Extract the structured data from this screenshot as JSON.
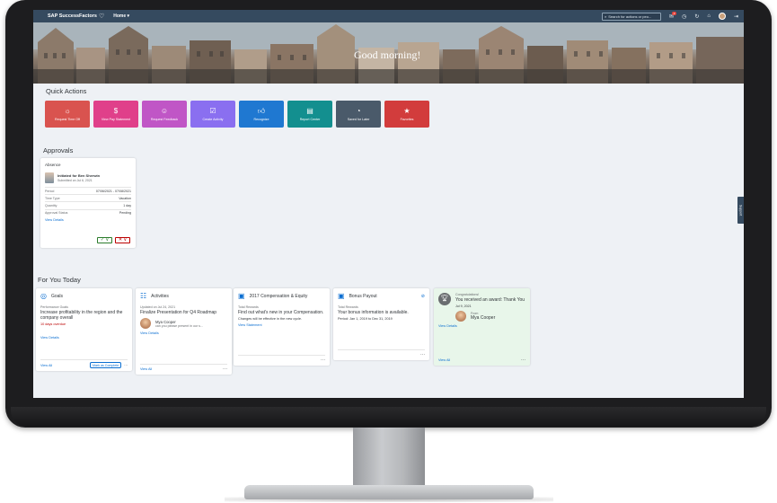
{
  "topbar": {
    "brand": "SAP SuccessFactors",
    "home_menu": "Home ▾",
    "search_placeholder": "Search for actions or peo...",
    "notification_count": "2"
  },
  "banner": {
    "greeting": "Good morning!"
  },
  "quick_actions": {
    "title": "Quick Actions",
    "tiles": [
      {
        "label": "Request Time Off",
        "icon": "sun-icon",
        "color": "#d9534f"
      },
      {
        "label": "View Pay Statement",
        "icon": "dollar-doc-icon",
        "color": "#e0408a"
      },
      {
        "label": "Request Feedback",
        "icon": "people-icon",
        "color": "#c056c6"
      },
      {
        "label": "Create Activity",
        "icon": "clipboard-icon",
        "color": "#8a6ff0"
      },
      {
        "label": "Recognize",
        "icon": "thumbs-up-icon",
        "color": "#1f78d1"
      },
      {
        "label": "Report Center",
        "icon": "report-icon",
        "color": "#138f8f"
      },
      {
        "label": "Saved for Later",
        "icon": "bookmark-icon",
        "color": "#4a5a6a"
      },
      {
        "label": "Favorites",
        "icon": "star-icon",
        "color": "#d23c3c"
      }
    ]
  },
  "approvals": {
    "title": "Approvals",
    "card": {
      "title": "Absence",
      "initiated": "Initiated for Ben Sherwin",
      "submitted": "Submitted on Jul 6, 2021",
      "rows": [
        {
          "k": "Period",
          "v": "07/06/2021 - 07/08/2021"
        },
        {
          "k": "Time Type",
          "v": "Vacation"
        },
        {
          "k": "Quantity",
          "v": "1 day"
        },
        {
          "k": "Approval Status",
          "v": "Pending"
        }
      ],
      "view_details": "View Details",
      "accept": "✓ ∨",
      "reject": "✕ ∨"
    }
  },
  "support_tab": "Support",
  "for_you": {
    "title": "For You Today",
    "goals": {
      "title": "Goals",
      "category": "Performance Goals",
      "main": "Increase profitability in the region and the company overall",
      "note": "10 days overdue",
      "link": "View Details",
      "view_all": "View All",
      "mark": "Mark as Complete",
      "more": "···"
    },
    "activities": {
      "title": "Activities",
      "category": "Updated on Jul 24, 2021",
      "main": "Finalize Presentation for Q4 Roadmap",
      "person": "Mya Cooper",
      "snippet": "can you please present in our s...",
      "link": "View Details",
      "view_all": "View All",
      "more": "···"
    },
    "compensation": {
      "title": "2017 Compensation & Equity",
      "category": "Total Rewards",
      "main": "Find out what's new in your Compensation.",
      "note": "Changes will be effective in the new cycle.",
      "link": "View Statement",
      "more": "···"
    },
    "bonus": {
      "title": "Bonus Payout",
      "category": "Total Rewards",
      "main": "Your bonus information is available.",
      "note": "Period: Jan 1, 2019 to Dec 31, 2019",
      "more": "···"
    },
    "award": {
      "congrats": "Congratulations!",
      "main": "You received an award: Thank You",
      "date": "Jul 9, 2021",
      "from_label": "From",
      "person": "Mya Cooper",
      "link": "View Details",
      "view_all": "View All",
      "more": "···"
    }
  }
}
